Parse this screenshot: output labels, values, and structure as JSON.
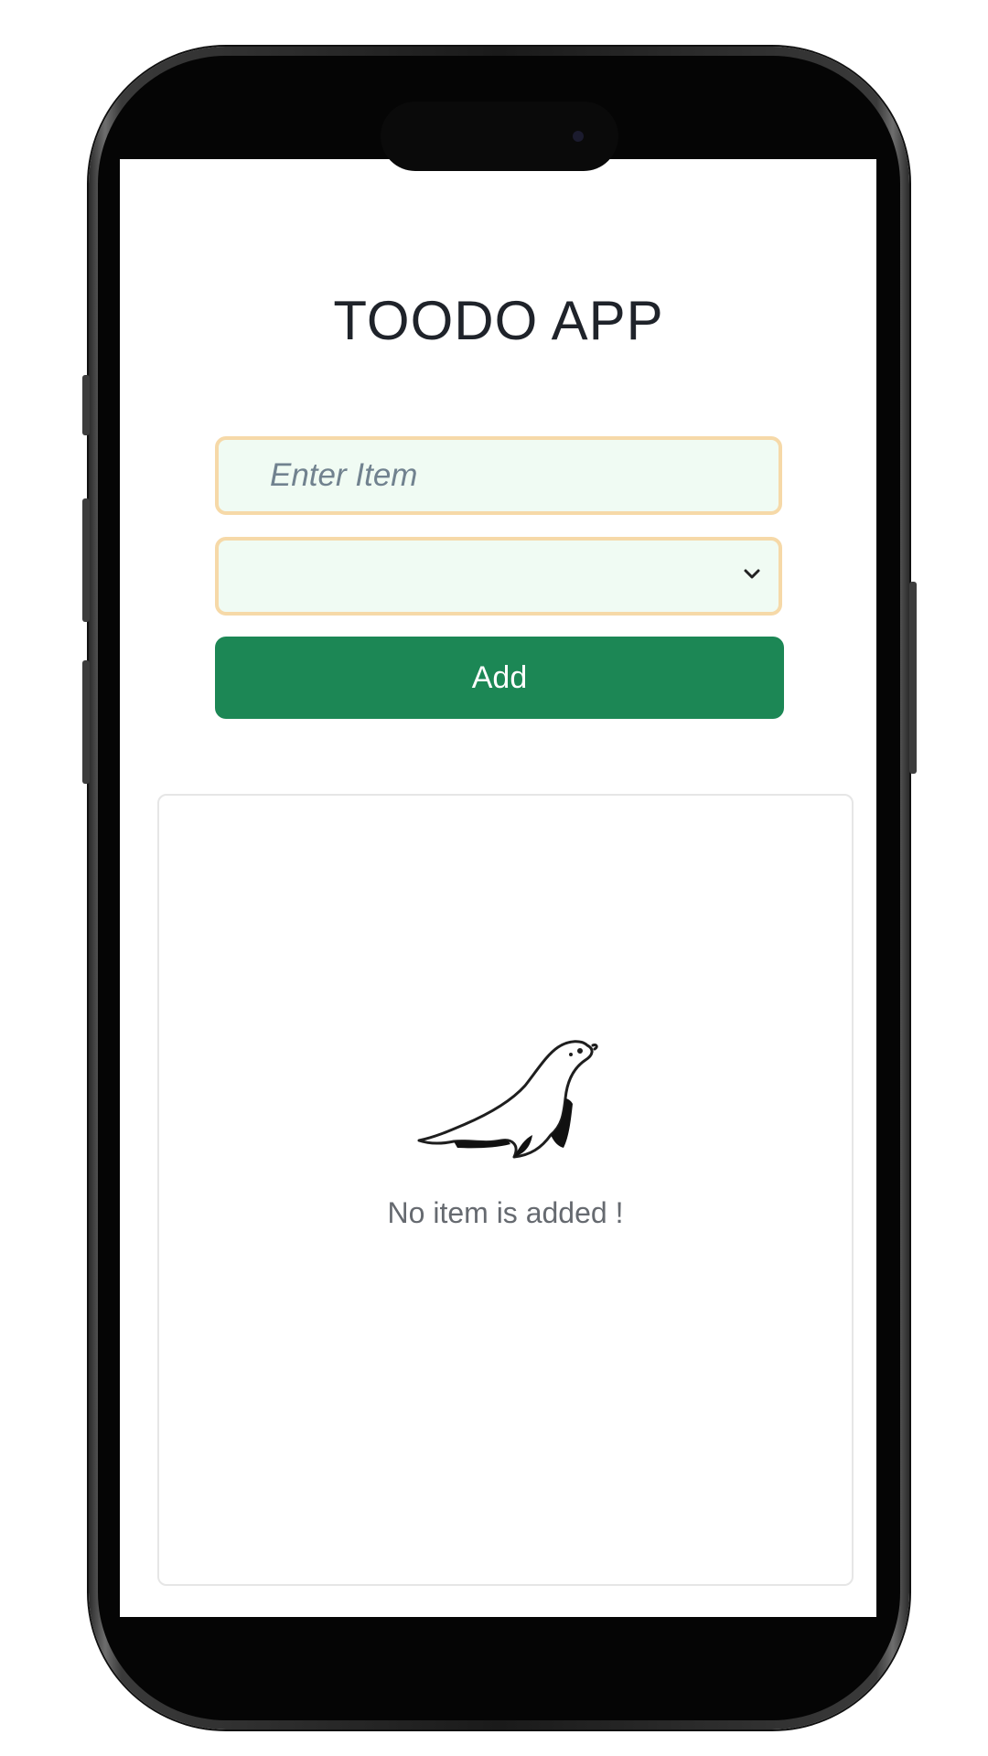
{
  "app": {
    "title": "TOODO APP"
  },
  "form": {
    "item_input": {
      "placeholder": "Enter Item",
      "value": ""
    },
    "category_select": {
      "selected": "",
      "icon": "chevron-down-icon"
    },
    "add_button_label": "Add"
  },
  "list": {
    "items": [],
    "empty_state": {
      "icon": "seal-icon",
      "message": "No item is added !"
    }
  },
  "colors": {
    "accent": "#1c8755",
    "field_background": "#f0fbf3",
    "field_border": "#f6d9a8",
    "title_text": "#1f232a"
  }
}
